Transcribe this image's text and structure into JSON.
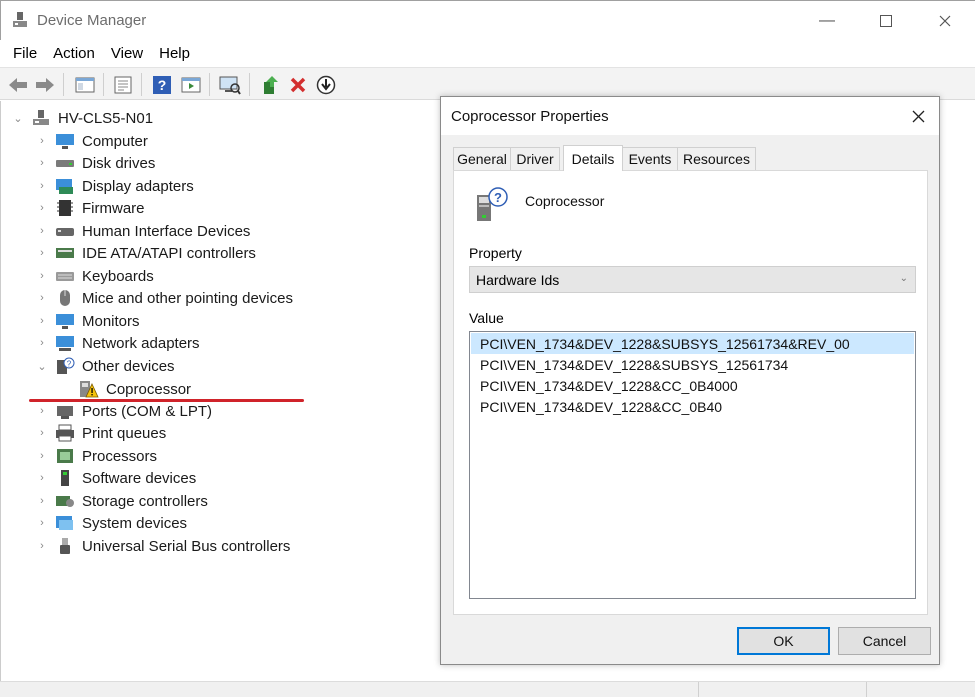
{
  "window": {
    "title": "Device Manager"
  },
  "menu": [
    "File",
    "Action",
    "View",
    "Help"
  ],
  "toolbar": [
    "back-icon",
    "forward-icon",
    "show-hide-tree-icon",
    "properties-icon",
    "help-icon",
    "action-view-icon",
    "scan-hardware-icon",
    "update-driver-icon",
    "uninstall-icon",
    "disable-icon"
  ],
  "tree": {
    "root": "HV-CLS5-N01",
    "items": [
      {
        "label": "Computer",
        "expanded": false,
        "icon": "computer-icon",
        "color": "#3b8fd9"
      },
      {
        "label": "Disk drives",
        "expanded": false,
        "icon": "disk-icon",
        "color": "#7a7a7a"
      },
      {
        "label": "Display adapters",
        "expanded": false,
        "icon": "display-adapter-icon",
        "color": "#2e8b57"
      },
      {
        "label": "Firmware",
        "expanded": false,
        "icon": "firmware-icon",
        "color": "#333333"
      },
      {
        "label": "Human Interface Devices",
        "expanded": false,
        "icon": "hid-icon",
        "color": "#666666"
      },
      {
        "label": "IDE ATA/ATAPI controllers",
        "expanded": false,
        "icon": "ide-icon",
        "color": "#4a7a4a"
      },
      {
        "label": "Keyboards",
        "expanded": false,
        "icon": "keyboard-icon",
        "color": "#9a9a9a"
      },
      {
        "label": "Mice and other pointing devices",
        "expanded": false,
        "icon": "mouse-icon",
        "color": "#777777"
      },
      {
        "label": "Monitors",
        "expanded": false,
        "icon": "monitor-icon",
        "color": "#3b8fd9"
      },
      {
        "label": "Network adapters",
        "expanded": false,
        "icon": "network-icon",
        "color": "#3b8fd9"
      },
      {
        "label": "Other devices",
        "expanded": true,
        "icon": "other-devices-icon",
        "color": "#555555"
      },
      {
        "label": "Ports (COM & LPT)",
        "expanded": false,
        "icon": "ports-icon",
        "color": "#666666"
      },
      {
        "label": "Print queues",
        "expanded": false,
        "icon": "printer-icon",
        "color": "#555555"
      },
      {
        "label": "Processors",
        "expanded": false,
        "icon": "processor-icon",
        "color": "#4a7a4a"
      },
      {
        "label": "Software devices",
        "expanded": false,
        "icon": "software-device-icon",
        "color": "#444444"
      },
      {
        "label": "Storage controllers",
        "expanded": false,
        "icon": "storage-controller-icon",
        "color": "#4a7a4a"
      },
      {
        "label": "System devices",
        "expanded": false,
        "icon": "system-devices-icon",
        "color": "#3b8fd9"
      },
      {
        "label": "Universal Serial Bus controllers",
        "expanded": false,
        "icon": "usb-icon",
        "color": "#555555"
      }
    ],
    "child": {
      "label": "Coprocessor",
      "icon": "warning-device-icon"
    }
  },
  "dialog": {
    "title": "Coprocessor Properties",
    "tabs": [
      "General",
      "Driver",
      "Details",
      "Events",
      "Resources"
    ],
    "active_tab": "Details",
    "device_name": "Coprocessor",
    "property_label": "Property",
    "property_value": "Hardware Ids",
    "value_label": "Value",
    "values": [
      "PCI\\VEN_1734&DEV_1228&SUBSYS_12561734&REV_00",
      "PCI\\VEN_1734&DEV_1228&SUBSYS_12561734",
      "PCI\\VEN_1734&DEV_1228&CC_0B4000",
      "PCI\\VEN_1734&DEV_1228&CC_0B40"
    ],
    "ok_label": "OK",
    "cancel_label": "Cancel"
  },
  "colors": {
    "accent": "#0078d7",
    "selection": "#cce8ff",
    "annotation": "#d0232a"
  }
}
